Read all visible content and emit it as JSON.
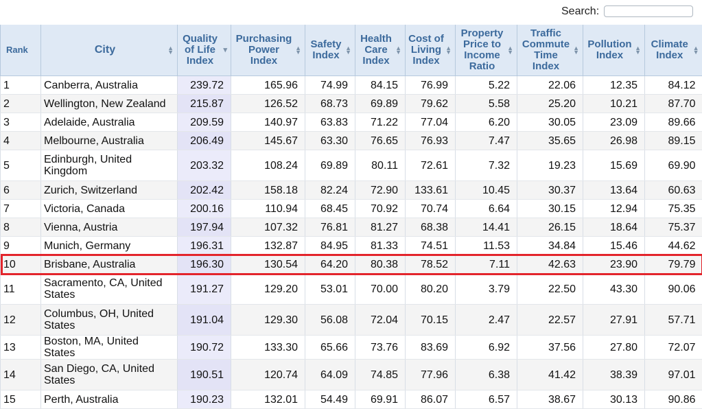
{
  "search": {
    "label": "Search:",
    "value": ""
  },
  "columns": [
    {
      "label": "Rank",
      "sorted": false
    },
    {
      "label": "City",
      "sorted": false
    },
    {
      "label": "Quality of Life Index",
      "sorted": true
    },
    {
      "label": "Purchasing Power Index",
      "sorted": false
    },
    {
      "label": "Safety Index",
      "sorted": false
    },
    {
      "label": "Health Care Index",
      "sorted": false
    },
    {
      "label": "Cost of Living Index",
      "sorted": false
    },
    {
      "label": "Property Price to Income Ratio",
      "sorted": false
    },
    {
      "label": "Traffic Commute Time Index",
      "sorted": false
    },
    {
      "label": "Pollution Index",
      "sorted": false
    },
    {
      "label": "Climate Index",
      "sorted": false
    }
  ],
  "rows": [
    {
      "rank": "1",
      "city": "Canberra, Australia",
      "qol": "239.72",
      "ppi": "165.96",
      "safety": "74.99",
      "health": "84.15",
      "col": "76.99",
      "ppr": "5.22",
      "traffic": "22.06",
      "pollution": "12.35",
      "climate": "84.12",
      "tall": false
    },
    {
      "rank": "2",
      "city": "Wellington, New Zealand",
      "qol": "215.87",
      "ppi": "126.52",
      "safety": "68.73",
      "health": "69.89",
      "col": "79.62",
      "ppr": "5.58",
      "traffic": "25.20",
      "pollution": "10.21",
      "climate": "87.70",
      "tall": false
    },
    {
      "rank": "3",
      "city": "Adelaide, Australia",
      "qol": "209.59",
      "ppi": "140.97",
      "safety": "63.83",
      "health": "71.22",
      "col": "77.04",
      "ppr": "6.20",
      "traffic": "30.05",
      "pollution": "23.09",
      "climate": "89.66",
      "tall": false
    },
    {
      "rank": "4",
      "city": "Melbourne, Australia",
      "qol": "206.49",
      "ppi": "145.67",
      "safety": "63.30",
      "health": "76.65",
      "col": "76.93",
      "ppr": "7.47",
      "traffic": "35.65",
      "pollution": "26.98",
      "climate": "89.15",
      "tall": false
    },
    {
      "rank": "5",
      "city": "Edinburgh, United Kingdom",
      "qol": "203.32",
      "ppi": "108.24",
      "safety": "69.89",
      "health": "80.11",
      "col": "72.61",
      "ppr": "7.32",
      "traffic": "19.23",
      "pollution": "15.69",
      "climate": "69.90",
      "tall": true
    },
    {
      "rank": "6",
      "city": "Zurich, Switzerland",
      "qol": "202.42",
      "ppi": "158.18",
      "safety": "82.24",
      "health": "72.90",
      "col": "133.61",
      "ppr": "10.45",
      "traffic": "30.37",
      "pollution": "13.64",
      "climate": "60.63",
      "tall": false
    },
    {
      "rank": "7",
      "city": "Victoria, Canada",
      "qol": "200.16",
      "ppi": "110.94",
      "safety": "68.45",
      "health": "70.92",
      "col": "70.74",
      "ppr": "6.64",
      "traffic": "30.15",
      "pollution": "12.94",
      "climate": "75.35",
      "tall": false
    },
    {
      "rank": "8",
      "city": "Vienna, Austria",
      "qol": "197.94",
      "ppi": "107.32",
      "safety": "76.81",
      "health": "81.27",
      "col": "68.38",
      "ppr": "14.41",
      "traffic": "26.15",
      "pollution": "18.64",
      "climate": "75.37",
      "tall": false
    },
    {
      "rank": "9",
      "city": "Munich, Germany",
      "qol": "196.31",
      "ppi": "132.87",
      "safety": "84.95",
      "health": "81.33",
      "col": "74.51",
      "ppr": "11.53",
      "traffic": "34.84",
      "pollution": "15.46",
      "climate": "44.62",
      "tall": false
    },
    {
      "rank": "10",
      "city": "Brisbane, Australia",
      "qol": "196.30",
      "ppi": "130.54",
      "safety": "64.20",
      "health": "80.38",
      "col": "78.52",
      "ppr": "7.11",
      "traffic": "42.63",
      "pollution": "23.90",
      "climate": "79.79",
      "tall": false
    },
    {
      "rank": "11",
      "city": "Sacramento, CA, United States",
      "qol": "191.27",
      "ppi": "129.20",
      "safety": "53.01",
      "health": "70.00",
      "col": "80.20",
      "ppr": "3.79",
      "traffic": "22.50",
      "pollution": "43.30",
      "climate": "90.06",
      "tall": true
    },
    {
      "rank": "12",
      "city": "Columbus, OH, United States",
      "qol": "191.04",
      "ppi": "129.30",
      "safety": "56.08",
      "health": "72.04",
      "col": "70.15",
      "ppr": "2.47",
      "traffic": "22.57",
      "pollution": "27.91",
      "climate": "57.71",
      "tall": true
    },
    {
      "rank": "13",
      "city": "Boston, MA, United States",
      "qol": "190.72",
      "ppi": "133.30",
      "safety": "65.66",
      "health": "73.76",
      "col": "83.69",
      "ppr": "6.92",
      "traffic": "37.56",
      "pollution": "27.80",
      "climate": "72.07",
      "tall": false
    },
    {
      "rank": "14",
      "city": "San Diego, CA, United States",
      "qol": "190.51",
      "ppi": "120.74",
      "safety": "64.09",
      "health": "74.85",
      "col": "77.96",
      "ppr": "6.38",
      "traffic": "41.42",
      "pollution": "38.39",
      "climate": "97.01",
      "tall": true
    },
    {
      "rank": "15",
      "city": "Perth, Australia",
      "qol": "190.23",
      "ppi": "132.01",
      "safety": "54.49",
      "health": "69.91",
      "col": "86.07",
      "ppr": "6.57",
      "traffic": "38.67",
      "pollution": "30.13",
      "climate": "90.86",
      "tall": false
    }
  ],
  "highlighted_rank": "10",
  "icons": {
    "sort": "sort-icon",
    "sort_active": "sort-desc-icon"
  },
  "colors": {
    "header_bg": "#dfe9f5",
    "header_text": "#3c6a9c",
    "highlight": "#e3242b",
    "qol_bg": "#ebebfa"
  }
}
